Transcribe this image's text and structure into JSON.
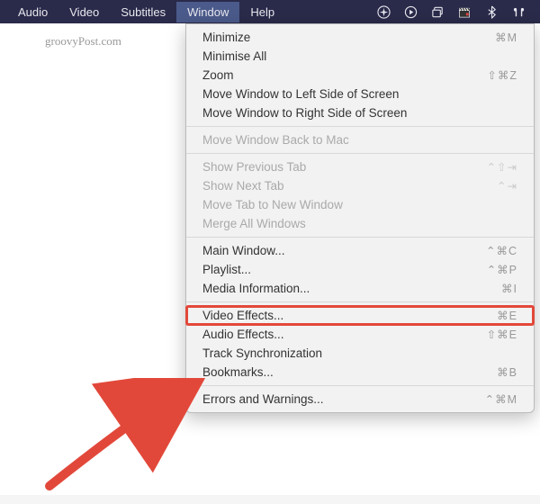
{
  "menubar": {
    "items": [
      {
        "label": "Audio"
      },
      {
        "label": "Video"
      },
      {
        "label": "Subtitles"
      },
      {
        "label": "Window",
        "active": true
      },
      {
        "label": "Help"
      }
    ]
  },
  "watermark": "groovyPost.com",
  "dropdown": {
    "minimize": {
      "label": "Minimize",
      "shortcut": "⌘M"
    },
    "minimise_all": {
      "label": "Minimise All"
    },
    "zoom": {
      "label": "Zoom",
      "shortcut": "⇧⌘Z"
    },
    "move_left": {
      "label": "Move Window to Left Side of Screen"
    },
    "move_right": {
      "label": "Move Window to Right Side of Screen"
    },
    "move_back": {
      "label": "Move Window Back to Mac"
    },
    "show_prev_tab": {
      "label": "Show Previous Tab",
      "shortcut": "⌃⇧⇥"
    },
    "show_next_tab": {
      "label": "Show Next Tab",
      "shortcut": "⌃⇥"
    },
    "move_tab": {
      "label": "Move Tab to New Window"
    },
    "merge_all": {
      "label": "Merge All Windows"
    },
    "main_window": {
      "label": "Main Window...",
      "shortcut": "⌃⌘C"
    },
    "playlist": {
      "label": "Playlist...",
      "shortcut": "⌃⌘P"
    },
    "media_info": {
      "label": "Media Information...",
      "shortcut": "⌘I"
    },
    "video_effects": {
      "label": "Video Effects...",
      "shortcut": "⌘E"
    },
    "audio_effects": {
      "label": "Audio Effects...",
      "shortcut": "⇧⌘E"
    },
    "track_sync": {
      "label": "Track Synchronization"
    },
    "bookmarks": {
      "label": "Bookmarks...",
      "shortcut": "⌘B"
    },
    "errors": {
      "label": "Errors and Warnings...",
      "shortcut": "⌃⌘M"
    }
  }
}
